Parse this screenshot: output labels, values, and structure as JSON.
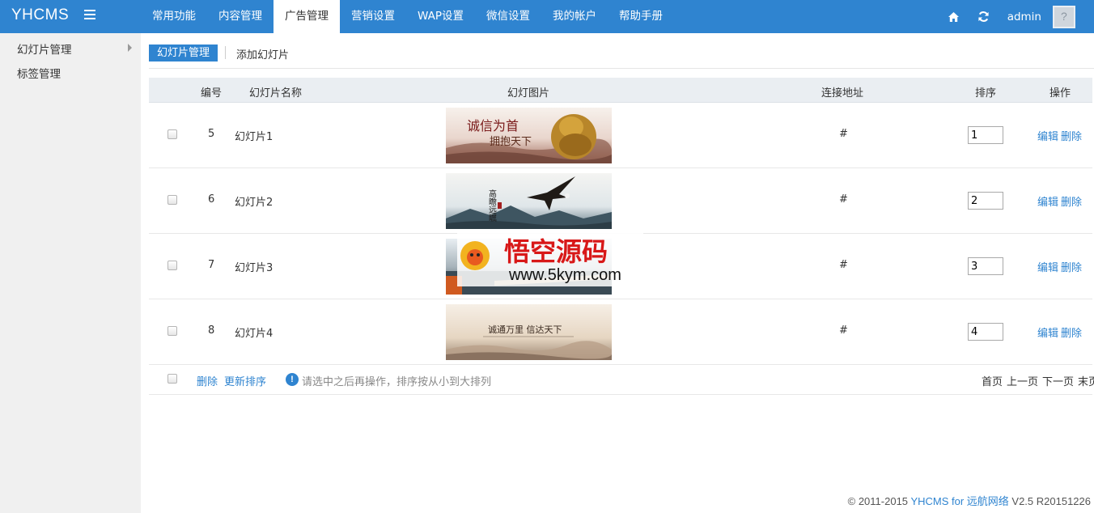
{
  "app": {
    "title": "YHCMS"
  },
  "nav": {
    "items": [
      {
        "label": "常用功能",
        "active": false
      },
      {
        "label": "内容管理",
        "active": false
      },
      {
        "label": "广告管理",
        "active": true
      },
      {
        "label": "营销设置",
        "active": false
      },
      {
        "label": "WAP设置",
        "active": false
      },
      {
        "label": "微信设置",
        "active": false
      },
      {
        "label": "我的帐户",
        "active": false
      },
      {
        "label": "帮助手册",
        "active": false
      }
    ],
    "username": "admin",
    "icons": [
      "home-icon",
      "refresh-icon",
      "avatar"
    ]
  },
  "sidebar": {
    "items": [
      {
        "label": "幻灯片管理",
        "expandable": true
      },
      {
        "label": "标签管理",
        "expandable": false
      }
    ]
  },
  "tabs": {
    "active": "幻灯片管理",
    "add": "添加幻灯片"
  },
  "table": {
    "headers": [
      "编号",
      "幻灯片名称",
      "幻灯图片",
      "连接地址",
      "排序",
      "操作"
    ],
    "rows": [
      {
        "id": "5",
        "name": "幻灯片1",
        "link": "#",
        "order": "1",
        "image_text": [
          "诚信为首",
          "拥抱天下"
        ]
      },
      {
        "id": "6",
        "name": "幻灯片2",
        "link": "#",
        "order": "2",
        "image_text": [
          "高瞻远瞩"
        ]
      },
      {
        "id": "7",
        "name": "幻灯片3",
        "link": "#",
        "order": "3",
        "image_text": []
      },
      {
        "id": "8",
        "name": "幻灯片4",
        "link": "#",
        "order": "4",
        "image_text": [
          "诚通万里 信达天下"
        ]
      }
    ],
    "ops": {
      "edit": "编辑",
      "delete": "删除"
    }
  },
  "footer": {
    "delete": "删除",
    "update_order": "更新排序",
    "tip": "请选中之后再操作，排序按从小到大排列",
    "pager": [
      "首页",
      "上一页",
      "下一页",
      "末页"
    ]
  },
  "copyright": {
    "prefix": "© 2011-2015",
    "brand": "YHCMS for 远航网络",
    "version": "V2.5 R20151226"
  },
  "watermark": {
    "title": "悟空源码",
    "url": "www.5kym.com"
  },
  "colors": {
    "topbar": "#2f84d0",
    "link": "#2f84d0",
    "sidebar": "#f0f0f0"
  }
}
